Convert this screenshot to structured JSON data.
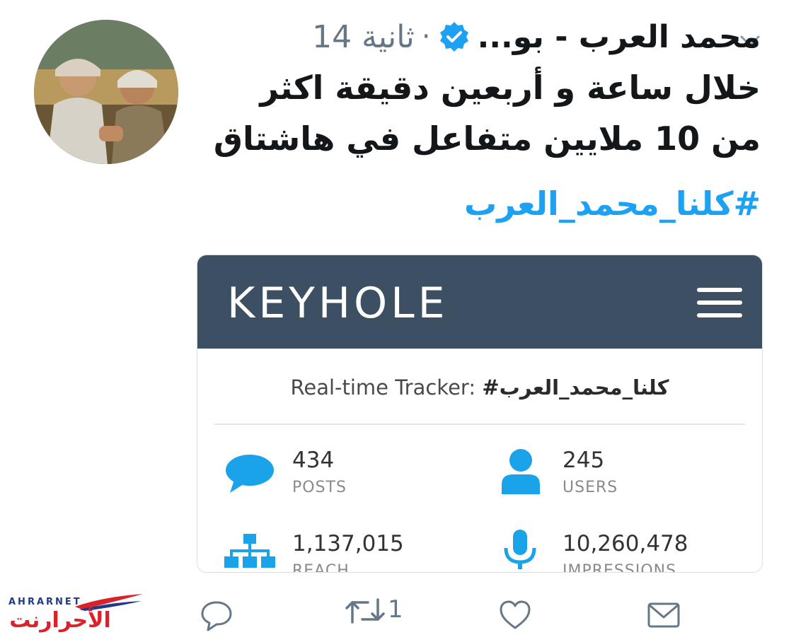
{
  "tweet": {
    "author_name": "محمد العرب - بو...",
    "time": "14 ثانية",
    "separator": "·",
    "text_line1": "خلال ساعة و أربعين دقيقة اكثر",
    "text_line2": "من 10 ملايين متفاعل في هاشتاق",
    "hashtag": "#كلنا_محمد_العرب"
  },
  "card": {
    "logo_text": "KEYHOLE",
    "tracker_label": "Real-time Tracker:",
    "tracker_hashtag": "#كلنا_محمد_العرب",
    "stats": [
      {
        "value": "434",
        "label": "POSTS",
        "icon": "speech-bubble-icon"
      },
      {
        "value": "245",
        "label": "USERS",
        "icon": "user-icon"
      },
      {
        "value": "1,137,015",
        "label": "REACH",
        "icon": "network-icon"
      },
      {
        "value": "10,260,478",
        "label": "IMPRESSIONS",
        "icon": "microphone-icon"
      }
    ]
  },
  "actions": {
    "retweet_count": "1"
  },
  "watermark": {
    "latin": "AHRARNET",
    "arabic": "الأحرارنت"
  },
  "colors": {
    "accent": "#1da1f2",
    "card_header": "#3c4f63",
    "stat_icon": "#1aa3e8",
    "watermark_red": "#d8232a",
    "watermark_navy": "#1f3a8a"
  }
}
